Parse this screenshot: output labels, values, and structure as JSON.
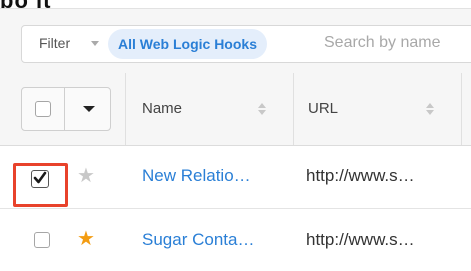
{
  "top_fragment": "bo it",
  "filter": {
    "label": "Filter",
    "active_filter": "All Web Logic Hooks",
    "search_placeholder": "Search by name"
  },
  "table": {
    "columns": [
      {
        "label": "Name",
        "sortable": true
      },
      {
        "label": "URL",
        "sortable": true
      }
    ],
    "rows": [
      {
        "name": "New Relatio…",
        "url": "http://www.s…",
        "selected": true,
        "favorite": false
      },
      {
        "name": "Sugar Conta…",
        "url": "http://www.s…",
        "selected": false,
        "favorite": true
      }
    ]
  },
  "icons": {
    "star_filled": "★",
    "star_color_favorite": "#f39c12",
    "star_color_default": "#c8c8c8"
  },
  "colors": {
    "link": "#2a7fd6",
    "highlight_box": "#e8422b"
  }
}
